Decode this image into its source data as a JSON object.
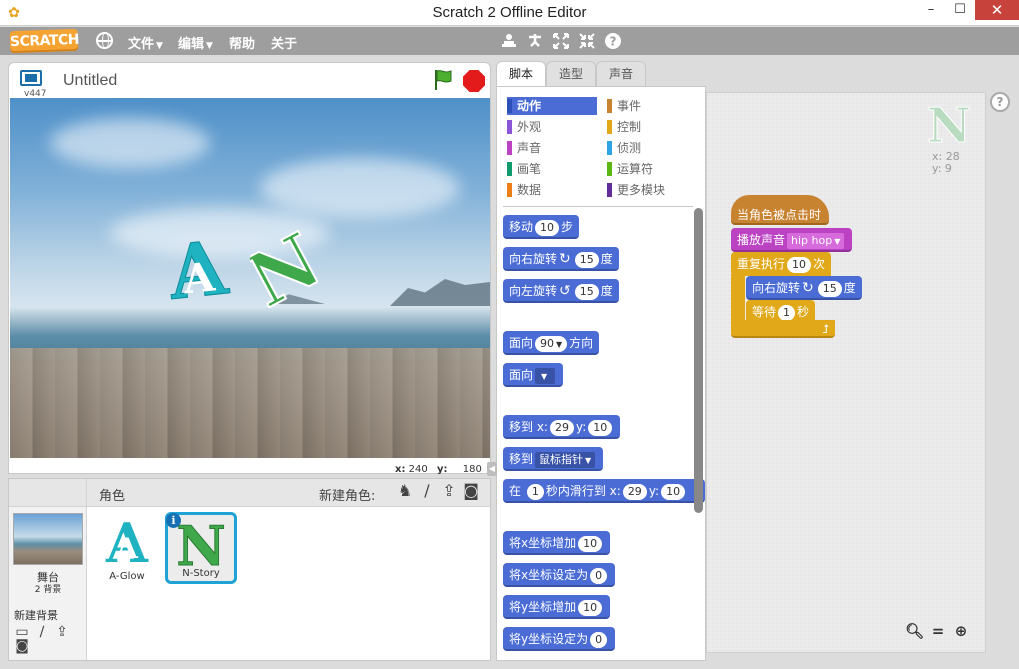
{
  "window": {
    "title": "Scratch 2 Offline Editor",
    "minimize": "–",
    "maximize": "☐",
    "close": "✕"
  },
  "menubar": {
    "logo": "SCRATCH",
    "items": [
      "文件",
      "编辑",
      "帮助",
      "关于"
    ],
    "tools": [
      "duplicate-icon",
      "cut-icon",
      "grow-icon",
      "shrink-icon",
      "help-icon"
    ]
  },
  "stage": {
    "version": "v447",
    "project_title": "Untitled",
    "coords": {
      "x_label": "x:",
      "x": "240",
      "y_label": "y:",
      "y": "180"
    }
  },
  "sprites_panel": {
    "stage_label": "舞台",
    "stage_backdrops": "2 背景",
    "new_backdrop": "新建背景",
    "header": "角色",
    "new_sprite": "新建角色:",
    "sprites": [
      {
        "name": "A-Glow",
        "glyph": "A",
        "selected": false
      },
      {
        "name": "N-Story",
        "glyph": "N",
        "selected": true
      }
    ]
  },
  "tabs": [
    "脚本",
    "造型",
    "声音"
  ],
  "categories": {
    "left": [
      {
        "label": "动作",
        "color": "#4a6cd4",
        "active": true
      },
      {
        "label": "外观",
        "color": "#8a55d7"
      },
      {
        "label": "声音",
        "color": "#bb42c3"
      },
      {
        "label": "画笔",
        "color": "#0e9a6c"
      },
      {
        "label": "数据",
        "color": "#ee7d16"
      }
    ],
    "right": [
      {
        "label": "事件",
        "color": "#c88330"
      },
      {
        "label": "控制",
        "color": "#e1a91a"
      },
      {
        "label": "侦测",
        "color": "#2ca5e2"
      },
      {
        "label": "运算符",
        "color": "#5cb712"
      },
      {
        "label": "更多模块",
        "color": "#632d99"
      }
    ]
  },
  "palette_blocks": {
    "move": {
      "pre": "移动",
      "val": "10",
      "post": "步"
    },
    "turn_right": {
      "pre": "向右旋转",
      "val": "15",
      "post": "度"
    },
    "turn_left": {
      "pre": "向左旋转",
      "val": "15",
      "post": "度"
    },
    "point_dir": {
      "pre": "面向",
      "val": "90",
      "post": "方向"
    },
    "point_towards": {
      "pre": "面向"
    },
    "goto_xy": {
      "pre": "移到 x:",
      "x": "29",
      "mid": "y:",
      "y": "10"
    },
    "goto": {
      "pre": "移到",
      "opt": "鼠标指针"
    },
    "glide": {
      "pre": "在",
      "secs": "1",
      "mid": "秒内滑行到 x:",
      "x": "29",
      "ylbl": "y:",
      "y": "10"
    },
    "change_x": {
      "pre": "将x坐标增加",
      "val": "10"
    },
    "set_x": {
      "pre": "将x坐标设定为",
      "val": "0"
    },
    "change_y": {
      "pre": "将y坐标增加",
      "val": "10"
    },
    "set_y": {
      "pre": "将y坐标设定为",
      "val": "0"
    }
  },
  "script": {
    "hat": "当角色被点击时",
    "play_sound": {
      "pre": "播放声音",
      "opt": "hip hop"
    },
    "repeat": {
      "pre": "重复执行",
      "val": "10",
      "post": "次"
    },
    "turn": {
      "pre": "向右旋转",
      "val": "15",
      "post": "度"
    },
    "wait": {
      "pre": "等待",
      "val": "1",
      "post": "秒"
    },
    "sprite_info": {
      "glyph": "N",
      "x": "x: 28",
      "y": "y: 9"
    }
  }
}
